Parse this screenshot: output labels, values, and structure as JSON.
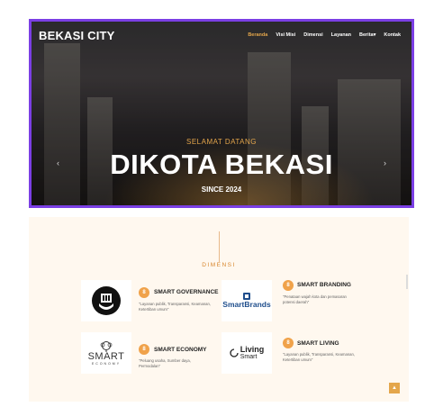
{
  "header": {
    "brand": "BEKASI CITY",
    "nav": [
      "Beranda",
      "Visi Misi",
      "Dimensi",
      "Layanan",
      "Berita",
      "Kontak"
    ],
    "berita_caret": "▾"
  },
  "hero": {
    "welcome": "SELAMAT DATANG",
    "title": "DIKOTA BEKASI",
    "since": "SINCE 2024"
  },
  "dimensi": {
    "heading": "DIMENSI",
    "badge_glyph": "8",
    "items": [
      {
        "title": "SMART GOVERNANCE",
        "desc": "\"Layanan publik, Transparansi, Keamanan, Ketertiban umum\""
      },
      {
        "title": "SMART BRANDING",
        "desc": "\"Penataan wajah kota dan pemasaran potensi daerah\""
      },
      {
        "title": "SMART ECONOMY",
        "desc": "\"Peluang usaha, Sumber daya, Permodalan\""
      },
      {
        "title": "SMART LIVING",
        "desc": "\"Layanan publik, Transparansi, Keamanan, Ketertiban umum\""
      }
    ],
    "logos": {
      "smartbrands": "SmartBrands",
      "smart_economy_big": "SMART",
      "smart_economy_small": "ECONOMY",
      "living": "Living",
      "smart": "Smart"
    }
  },
  "back_to_top": "▲",
  "colors": {
    "accent": "#e4a64b",
    "frame": "#7b3fe4",
    "section_bg": "#fff8ef"
  }
}
